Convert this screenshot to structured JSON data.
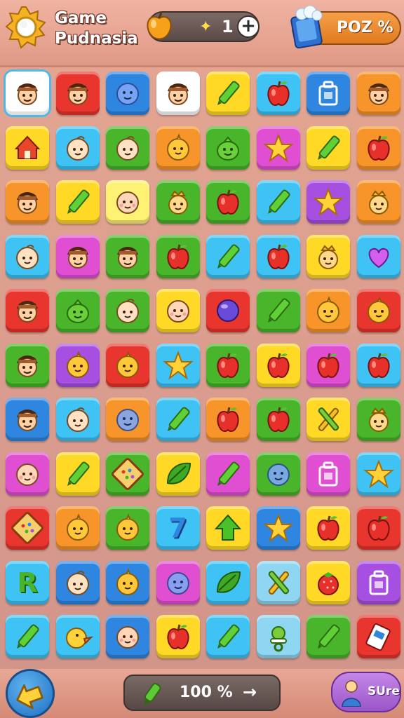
{
  "header": {
    "title_line1": "Game",
    "title_line2": "Pudnasia",
    "counter_value": "1",
    "counter_plus": "+",
    "poz_label": "POZ %"
  },
  "footer": {
    "progress_label": "100 %",
    "progress_arrow": "→",
    "sure_label": "SUre"
  },
  "colors": {
    "white": "#ffffff",
    "red": "#e8352d",
    "blue": "#2f86e0",
    "yellow": "#ffd926",
    "cyan": "#3fc3f5",
    "orange": "#f7942a",
    "green": "#49b52a",
    "purple": "#a64fe0",
    "magenta": "#e04fd2",
    "lightyellow": "#fff174",
    "lightblue": "#8fd6f2"
  },
  "board": {
    "rows": [
      [
        {
          "c": "white",
          "i": "boy"
        },
        {
          "c": "red",
          "i": "boy"
        },
        {
          "c": "blue",
          "i": "blob"
        },
        {
          "c": "white",
          "i": "boy"
        },
        {
          "c": "yellow",
          "i": "pencil"
        },
        {
          "c": "cyan",
          "i": "apple"
        },
        {
          "c": "blue",
          "i": "box"
        },
        {
          "c": "orange",
          "i": "boy"
        }
      ],
      [
        {
          "c": "yellow",
          "i": "house"
        },
        {
          "c": "cyan",
          "i": "baby"
        },
        {
          "c": "green",
          "i": "baby"
        },
        {
          "c": "orange",
          "i": "chick"
        },
        {
          "c": "green",
          "i": "dino"
        },
        {
          "c": "magenta",
          "i": "star"
        },
        {
          "c": "yellow",
          "i": "pencil"
        },
        {
          "c": "orange",
          "i": "apple"
        }
      ],
      [
        {
          "c": "orange",
          "i": "boy"
        },
        {
          "c": "yellow",
          "i": "pencil"
        },
        {
          "c": "lightyellow",
          "i": "babyface"
        },
        {
          "c": "green",
          "i": "king"
        },
        {
          "c": "green",
          "i": "apple"
        },
        {
          "c": "cyan",
          "i": "pencil"
        },
        {
          "c": "purple",
          "i": "star"
        },
        {
          "c": "orange",
          "i": "king"
        }
      ],
      [
        {
          "c": "cyan",
          "i": "baby"
        },
        {
          "c": "magenta",
          "i": "boy"
        },
        {
          "c": "green",
          "i": "boy"
        },
        {
          "c": "green",
          "i": "apple"
        },
        {
          "c": "cyan",
          "i": "pencil"
        },
        {
          "c": "cyan",
          "i": "apple"
        },
        {
          "c": "yellow",
          "i": "king"
        },
        {
          "c": "cyan",
          "i": "heart"
        }
      ],
      [
        {
          "c": "red",
          "i": "boy"
        },
        {
          "c": "green",
          "i": "dino"
        },
        {
          "c": "green",
          "i": "baby"
        },
        {
          "c": "yellow",
          "i": "babyface"
        },
        {
          "c": "red",
          "i": "ball"
        },
        {
          "c": "green",
          "i": "pencil"
        },
        {
          "c": "orange",
          "i": "chick"
        },
        {
          "c": "red",
          "i": "chick"
        }
      ],
      [
        {
          "c": "green",
          "i": "boy"
        },
        {
          "c": "purple",
          "i": "chick"
        },
        {
          "c": "red",
          "i": "chick"
        },
        {
          "c": "cyan",
          "i": "star"
        },
        {
          "c": "green",
          "i": "apple"
        },
        {
          "c": "yellow",
          "i": "apple"
        },
        {
          "c": "magenta",
          "i": "apple"
        },
        {
          "c": "cyan",
          "i": "apple"
        }
      ],
      [
        {
          "c": "blue",
          "i": "boy"
        },
        {
          "c": "cyan",
          "i": "baby"
        },
        {
          "c": "orange",
          "i": "blob"
        },
        {
          "c": "cyan",
          "i": "pencil"
        },
        {
          "c": "orange",
          "i": "apple"
        },
        {
          "c": "green",
          "i": "apple"
        },
        {
          "c": "yellow",
          "i": "cross"
        },
        {
          "c": "green",
          "i": "king"
        }
      ],
      [
        {
          "c": "magenta",
          "i": "babyface"
        },
        {
          "c": "yellow",
          "i": "pencil"
        },
        {
          "c": "green",
          "i": "board"
        },
        {
          "c": "yellow",
          "i": "leaf"
        },
        {
          "c": "magenta",
          "i": "pencil"
        },
        {
          "c": "green",
          "i": "blob"
        },
        {
          "c": "magenta",
          "i": "box"
        },
        {
          "c": "cyan",
          "i": "star"
        }
      ],
      [
        {
          "c": "red",
          "i": "board"
        },
        {
          "c": "orange",
          "i": "chick"
        },
        {
          "c": "green",
          "i": "chick"
        },
        {
          "c": "cyan",
          "i": "seven"
        },
        {
          "c": "yellow",
          "i": "arrowup"
        },
        {
          "c": "blue",
          "i": "star"
        },
        {
          "c": "yellow",
          "i": "apple"
        },
        {
          "c": "red",
          "i": "apple"
        }
      ],
      [
        {
          "c": "cyan",
          "i": "letterR"
        },
        {
          "c": "blue",
          "i": "baby"
        },
        {
          "c": "blue",
          "i": "chick"
        },
        {
          "c": "magenta",
          "i": "blob"
        },
        {
          "c": "cyan",
          "i": "leaf"
        },
        {
          "c": "lightblue",
          "i": "cross"
        },
        {
          "c": "yellow",
          "i": "berry"
        },
        {
          "c": "purple",
          "i": "box"
        }
      ],
      [
        {
          "c": "cyan",
          "i": "pencil"
        },
        {
          "c": "cyan",
          "i": "duck"
        },
        {
          "c": "blue",
          "i": "babyface"
        },
        {
          "c": "yellow",
          "i": "apple"
        },
        {
          "c": "cyan",
          "i": "pencil"
        },
        {
          "c": "lightblue",
          "i": "pacifier"
        },
        {
          "c": "green",
          "i": "pencil"
        },
        {
          "c": "red",
          "i": "card"
        }
      ]
    ],
    "seven_text": "7",
    "r_text": "R"
  }
}
